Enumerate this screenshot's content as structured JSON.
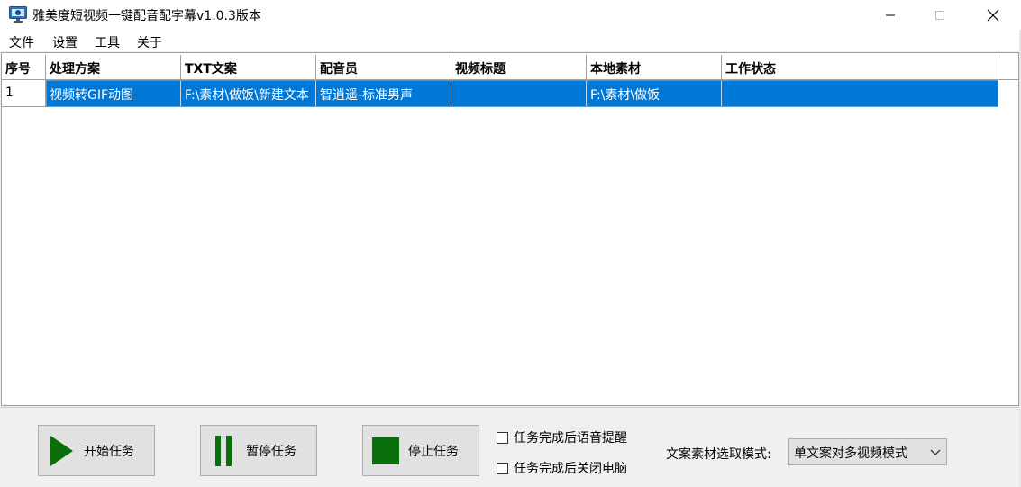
{
  "window": {
    "title": "雅美度短视频一键配音配字幕v1.0.3版本",
    "controls": [
      "minimize",
      "maximize",
      "close"
    ]
  },
  "menu": {
    "items": [
      "文件",
      "设置",
      "工具",
      "关于"
    ]
  },
  "grid": {
    "columns": [
      "序号",
      "处理方案",
      "TXT文案",
      "配音员",
      "视频标题",
      "本地素材",
      "工作状态"
    ],
    "rows": [
      {
        "index": "1",
        "scheme": "视频转GIF动图",
        "txt": "F:\\素材\\做饭\\新建文本",
        "voice": "智逍遥-标准男声",
        "video_title": "",
        "local": "F:\\素材\\做饭",
        "status": ""
      }
    ],
    "selection_color": "#0078d7"
  },
  "actions": {
    "start": "开始任务",
    "pause": "暂停任务",
    "stop": "停止任务",
    "icon_color": "#0a6e0a"
  },
  "options": {
    "voice_reminder": {
      "label": "任务完成后语音提醒",
      "checked": false
    },
    "shutdown": {
      "label": "任务完成后关闭电脑",
      "checked": false
    }
  },
  "mode": {
    "label": "文案素材选取模式:",
    "selected": "单文案对多视频模式"
  }
}
